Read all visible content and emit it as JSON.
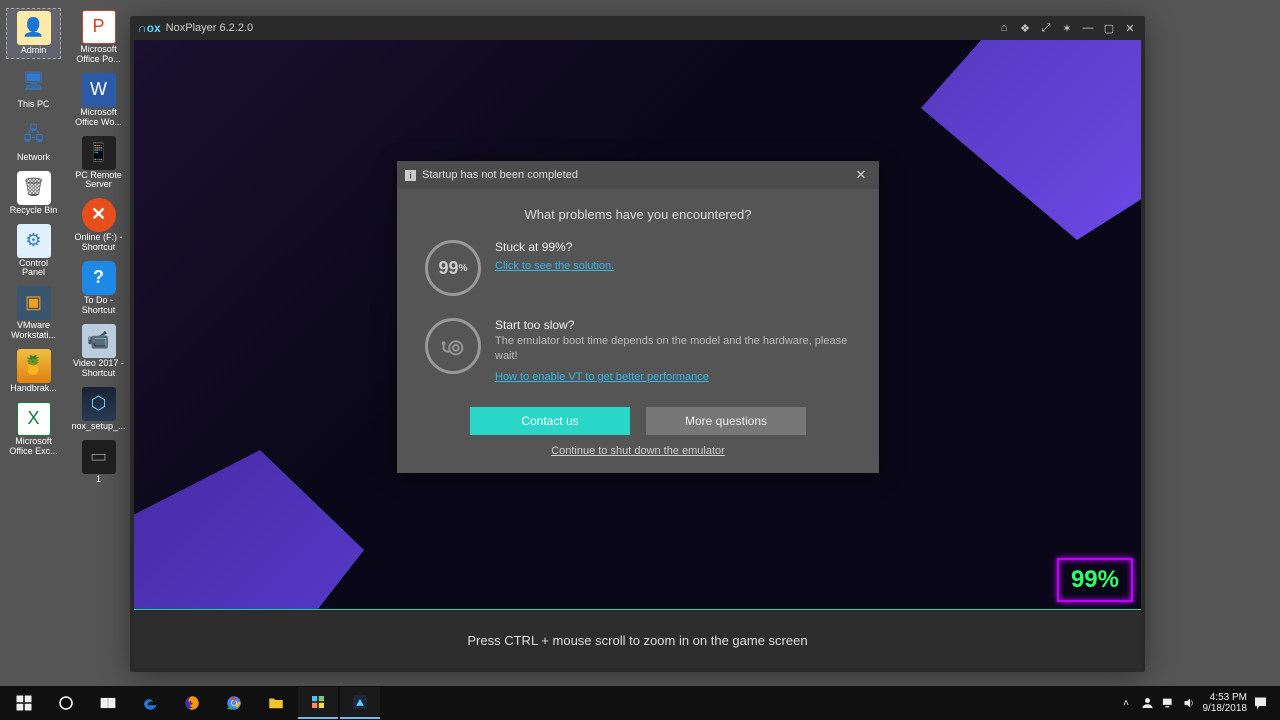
{
  "desktop": {
    "col1": [
      {
        "label": "Admin",
        "cls": "admin",
        "glyph": "👤",
        "sel": true
      },
      {
        "label": "This PC",
        "cls": "pc",
        "glyph": "🖥"
      },
      {
        "label": "Network",
        "cls": "net",
        "glyph": "🖧"
      },
      {
        "label": "Recycle Bin",
        "cls": "bin",
        "glyph": "🗑"
      },
      {
        "label": "Control Panel",
        "cls": "cp",
        "glyph": "⚙"
      },
      {
        "label": "VMware Workstati...",
        "cls": "vm",
        "glyph": "▣"
      },
      {
        "label": "Handbrak...",
        "cls": "hb",
        "glyph": "🍍"
      },
      {
        "label": "Microsoft Office Exc...",
        "cls": "exc",
        "glyph": "X"
      }
    ],
    "col2": [
      {
        "label": "Microsoft Office Po...",
        "cls": "ppt",
        "glyph": "P"
      },
      {
        "label": "Microsoft Office Wo...",
        "cls": "wrd",
        "glyph": "W"
      },
      {
        "label": "PC Remote Server",
        "cls": "pcr",
        "glyph": "📱"
      },
      {
        "label": "Online (F:) - Shortcut",
        "cls": "onf",
        "glyph": "✕"
      },
      {
        "label": "To Do - Shortcut",
        "cls": "todo",
        "glyph": "?"
      },
      {
        "label": "Video 2017 - Shortcut",
        "cls": "vid",
        "glyph": "📹"
      },
      {
        "label": "nox_setup_...",
        "cls": "nox",
        "glyph": "⬡"
      },
      {
        "label": "1",
        "cls": "dark",
        "glyph": "▭"
      }
    ]
  },
  "nox": {
    "title": "NoxPlayer 6.2.2.0",
    "footer_hint": "Press CTRL + mouse scroll to zoom in on the game screen",
    "progress": "99%"
  },
  "dialog": {
    "title": "Startup has not been completed",
    "question": "What problems have you encountered?",
    "s1_percent": "99",
    "s1_unit": "%",
    "s1_title": "Stuck at 99%?",
    "s1_link": "Click to see the solution.",
    "s2_title": "Start too slow?",
    "s2_desc": "The emulator boot time depends on the model and the hardware, please wait!",
    "s2_link": "How to enable VT to get better performance",
    "btn_contact": "Contact us",
    "btn_more": "More questions",
    "shutdown": "Continue to shut down the emulator"
  },
  "taskbar": {
    "time": "4:53 PM",
    "date": "9/18/2018"
  }
}
